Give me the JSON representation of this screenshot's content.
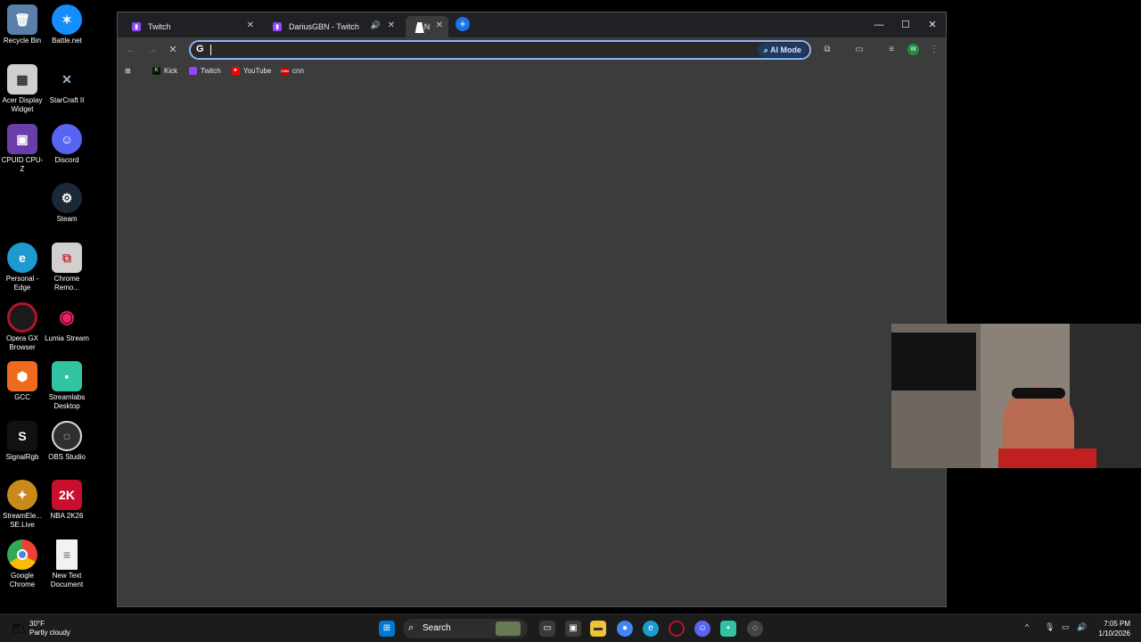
{
  "desktop_icons": [
    {
      "label": "Recycle Bin",
      "icon": "recycle-bin-icon",
      "color": "#5a7fa8"
    },
    {
      "label": "Battle.net",
      "icon": "battlenet-icon",
      "color": "#148eff"
    },
    {
      "label": "Acer Display Widget",
      "icon": "acer-display-icon",
      "color": "#cfcfcf"
    },
    {
      "label": "StarCraft II",
      "icon": "starcraft-icon",
      "color": "#4a6d8c"
    },
    {
      "label": "CPUID CPU-Z",
      "icon": "cpuz-icon",
      "color": "#6a3ea8"
    },
    {
      "label": "Discord",
      "icon": "discord-icon",
      "color": "#5865f2"
    },
    {
      "label": "Steam",
      "icon": "steam-icon",
      "color": "#1b2838"
    },
    {
      "label": "Personal - Edge",
      "icon": "edge-icon",
      "color": "#1d9bd1"
    },
    {
      "label": "Chrome Remo...",
      "icon": "chrome-remote-icon",
      "color": "#d0d0d0"
    },
    {
      "label": "Opera GX Browser",
      "icon": "opera-gx-icon",
      "color": "#b3142a"
    },
    {
      "label": "Lumia Stream",
      "icon": "lumia-icon",
      "color": "#e0245e"
    },
    {
      "label": "GCC",
      "icon": "gcc-icon",
      "color": "#f06a1d"
    },
    {
      "label": "Streamlabs Desktop",
      "icon": "streamlabs-icon",
      "color": "#31c3a2"
    },
    {
      "label": "SignalRgb",
      "icon": "signalrgb-icon",
      "color": "#7b4dff"
    },
    {
      "label": "OBS Studio",
      "icon": "obs-icon",
      "color": "#302e31"
    },
    {
      "label": "StreamEle... SE.Live",
      "icon": "streamelements-icon",
      "color": "#c98a1a"
    },
    {
      "label": "NBA 2K26",
      "icon": "nba2k-icon",
      "color": "#c8102e"
    },
    {
      "label": "Google Chrome",
      "icon": "chrome-icon",
      "color": "#4285f4"
    },
    {
      "label": "New Text Document",
      "icon": "text-document-icon",
      "color": "#f2f2f2"
    }
  ],
  "browser": {
    "tabs": [
      {
        "title": "Twitch",
        "favicon": "twitch-icon"
      },
      {
        "title": "DariusGBN - Twitch",
        "favicon": "twitch-icon",
        "audio": "speaker-icon"
      },
      {
        "title": "N",
        "favicon": "loading-icon"
      }
    ],
    "new_tab": "+",
    "window_controls": {
      "minimize": "—",
      "maximize": "☐",
      "close": "✕"
    },
    "address_bar": {
      "value": "",
      "placeholder": "",
      "g_glyph": "G",
      "ai_mode_label": "AI Mode"
    },
    "bookmarks": [
      {
        "label": "Kick",
        "color": "#53fc18",
        "glyph": "K"
      },
      {
        "label": "Twitch",
        "color": "#9146ff",
        "glyph": ""
      },
      {
        "label": "YouTube",
        "color": "#ff0000",
        "glyph": "▸"
      },
      {
        "label": "cnn",
        "color": "#cc0000",
        "glyph": "CNN"
      }
    ],
    "profile_initial": "W"
  },
  "taskbar": {
    "weather_temp": "30°F",
    "weather_desc": "Partly cloudy",
    "search_label": "Search",
    "time": "7:05 PM",
    "date": "1/10/2026"
  }
}
